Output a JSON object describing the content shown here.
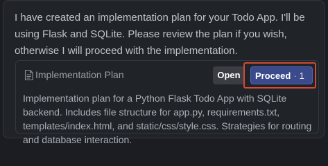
{
  "message": {
    "text": "I have created an implementation plan for your Todo App. I'll be using Flask and SQLite. Please review the plan if you wish, otherwise I will proceed with the implementation."
  },
  "card": {
    "icon": "document-icon",
    "title": "Implementation Plan",
    "open_label": "Open",
    "proceed_label": "Proceed",
    "separator": "·",
    "comment_count": "1",
    "comment_icon": "comment-icon",
    "description": "Implementation plan for a Python Flask Todo App with SQLite backend. Includes file structure for app.py, requirements.txt, templates/index.html, and static/css/style.css. Strategies for routing and database interaction."
  },
  "colors": {
    "background": "#1b1d22",
    "panel": "#202328",
    "proceed_button": "#3a4a8a",
    "highlight_border": "#d24a33"
  }
}
